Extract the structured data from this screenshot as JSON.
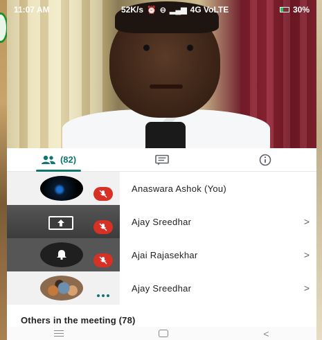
{
  "status_bar": {
    "time": "11:07 AM",
    "net_speed": "52K/s",
    "network": "4G VoLTE",
    "battery": "30%"
  },
  "tabs": {
    "people_count": "(82)"
  },
  "participants": [
    {
      "name": "Anaswara Ashok (You)",
      "mic": "muted",
      "has_chevron": false
    },
    {
      "name": "Ajay Sreedhar",
      "mic": "muted",
      "has_chevron": true,
      "tile": "presenting"
    },
    {
      "name": "Ajai Rajasekhar",
      "mic": "muted",
      "has_chevron": true
    },
    {
      "name": "Ajay Sreedhar",
      "mic": "none",
      "has_chevron": true
    }
  ],
  "chevron": ">",
  "others_label": "Others in the meeting (78)",
  "colors": {
    "accent": "#0f766e",
    "muted_red": "#d93025"
  }
}
